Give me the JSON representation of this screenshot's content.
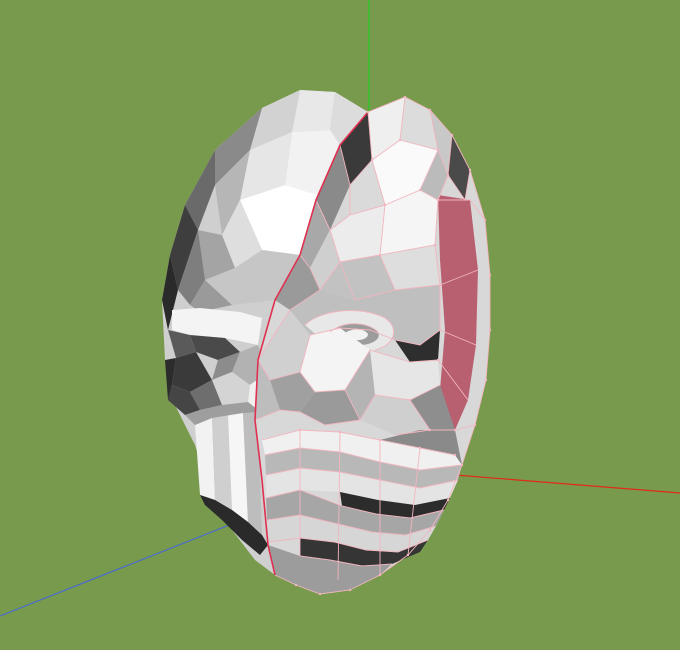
{
  "viewport": {
    "background": "#789a4c"
  },
  "axes": {
    "x_color": "#e02a18",
    "y_color": "#22cc22",
    "z_color": "#4a6ad0"
  },
  "model": {
    "wire_color": "#f2b5bf",
    "selection_color": "#e03050",
    "interior_tint": "#b86070"
  }
}
